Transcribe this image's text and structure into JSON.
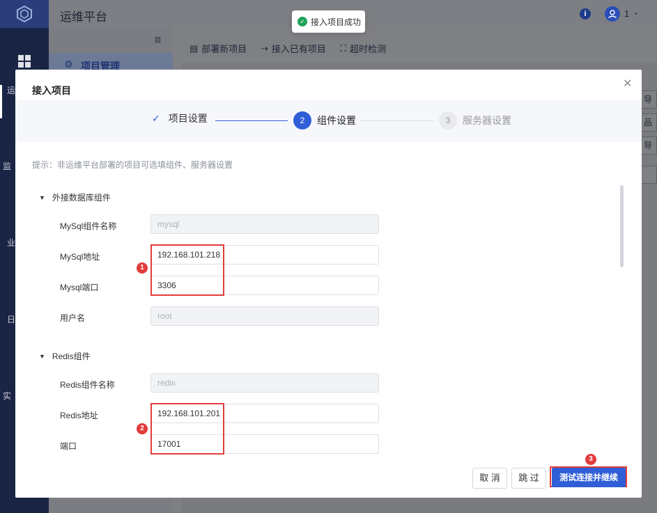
{
  "app": {
    "title": "运维平台",
    "user_number": "1"
  },
  "sidebar": {
    "items": [
      "运",
      "监",
      "业",
      "日",
      "实"
    ]
  },
  "subnav": {
    "active_label": "项目管理"
  },
  "toolbar": {
    "deploy_label": "部署新项目",
    "import_label": "接入已有项目",
    "timeout_label": "超时检测"
  },
  "peek": [
    "导",
    "品",
    "导"
  ],
  "toast": {
    "text": "接入项目成功"
  },
  "modal": {
    "title": "接入项目",
    "steps": [
      {
        "label": "项目设置",
        "status": "done"
      },
      {
        "number": "2",
        "label": "组件设置",
        "status": "active"
      },
      {
        "number": "3",
        "label": "服务器设置",
        "status": "pending"
      }
    ],
    "hint": "提示：非运维平台部署的项目可选填组件、服务器设置",
    "sections": {
      "db": {
        "title": "外接数据库组件",
        "fields": [
          {
            "label": "MySql组件名称",
            "value": "mysql",
            "disabled": true
          },
          {
            "label": "MySql地址",
            "value": "192.168.101.218",
            "disabled": false
          },
          {
            "label": "Mysql端口",
            "value": "3306",
            "disabled": false
          },
          {
            "label": "用户名",
            "value": "root",
            "disabled": true
          }
        ]
      },
      "redis": {
        "title": "Redis组件",
        "fields": [
          {
            "label": "Redis组件名称",
            "value": "redis",
            "disabled": true
          },
          {
            "label": "Redis地址",
            "value": "192.168.101.201",
            "disabled": false
          },
          {
            "label": "端口",
            "value": "17001",
            "disabled": false
          }
        ]
      }
    },
    "annotations": [
      "1",
      "2",
      "3"
    ],
    "buttons": {
      "cancel": "取 消",
      "skip": "跳 过",
      "test_continue": "测试连接并继续"
    }
  },
  "colors": {
    "primary": "#2f5ed6",
    "annotation_red": "#e23b3b",
    "success": "#21a35a"
  }
}
